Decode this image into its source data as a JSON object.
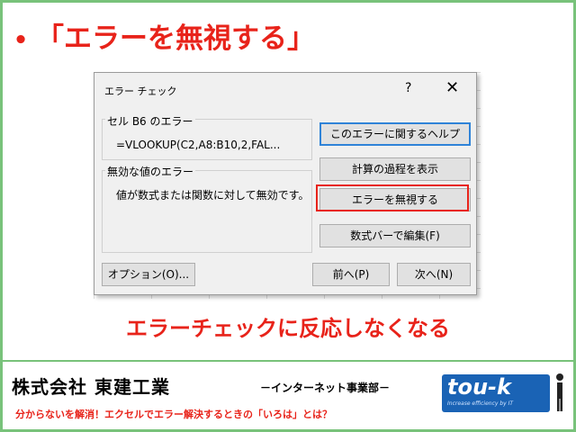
{
  "slide": {
    "bullet": "•",
    "title": "「エラーを無視する」",
    "caption": "エラーチェックに反応しなくなる"
  },
  "dialog": {
    "title": "エラー チェック",
    "help_symbol": "?",
    "close_symbol": "✕",
    "cell_group_label": "セル B6 のエラー",
    "formula": "=VLOOKUP(C2,A8:B10,2,FAL...",
    "error_group_label": "無効な値のエラー",
    "error_description": "値が数式または関数に対して無効です。",
    "buttons": {
      "help": "このエラーに関するヘルプ",
      "calc_steps": "計算の過程を表示",
      "ignore": "エラーを無視する",
      "edit_formula_bar": "数式バーで編集(F)",
      "options": "オプション(O)...",
      "prev": "前へ(P)",
      "next": "次へ(N)"
    }
  },
  "footer": {
    "company": "株式会社 東建工業",
    "division": "－インターネット事業部－",
    "tagline": "分からないを解消！エクセルでエラー解決するときの「いろは」とは？",
    "logo_text": "tou-k",
    "logo_sub": "Increase efficiency by IT"
  },
  "colors": {
    "accent_red": "#e8231a",
    "frame_green": "#78c27a",
    "logo_blue": "#1a63b5",
    "primary_button_border": "#2f83d8"
  }
}
